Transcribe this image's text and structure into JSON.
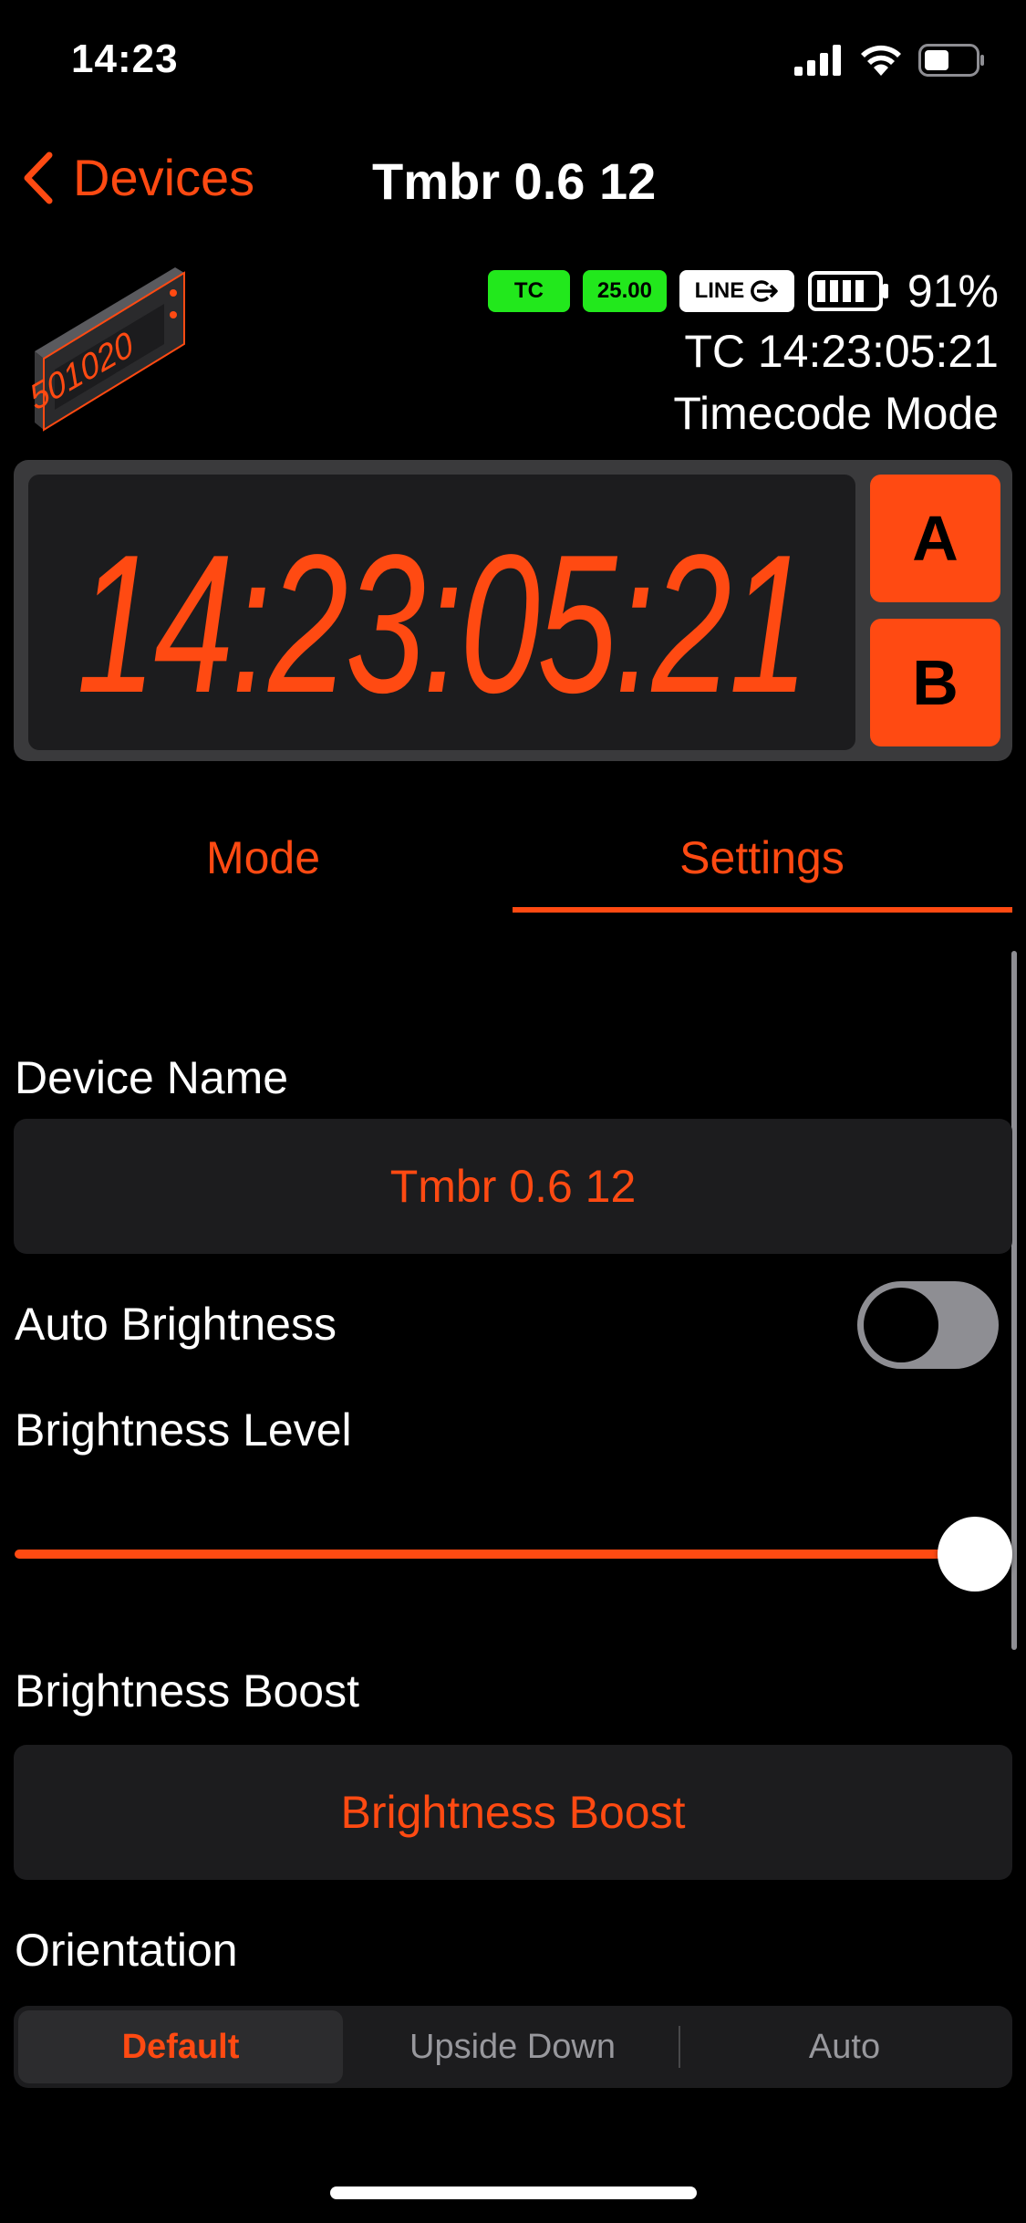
{
  "status_bar": {
    "time": "14:23",
    "icons": [
      "cellular-signal-icon",
      "wifi-icon",
      "battery-icon"
    ]
  },
  "nav": {
    "back_label": "Devices",
    "title": "Tmbr 0.6 12"
  },
  "device_header": {
    "badges": {
      "tc": "TC",
      "fps": "25.00",
      "line": "LINE"
    },
    "battery_percent": "91%",
    "battery_level": 0.91,
    "timecode": "TC 14:23:05:21",
    "mode": "Timecode Mode",
    "thumbnail_text": "501020"
  },
  "display": {
    "timecode": "14:23:05:21",
    "button_a": "A",
    "button_b": "B"
  },
  "tabs": {
    "mode": "Mode",
    "settings": "Settings",
    "selected": "settings"
  },
  "settings": {
    "device_name_label": "Device Name",
    "device_name_value": "Tmbr 0.6 12",
    "auto_brightness_label": "Auto Brightness",
    "auto_brightness_on": false,
    "brightness_level_label": "Brightness Level",
    "brightness_level": 1.0,
    "brightness_boost_label": "Brightness Boost",
    "brightness_boost_button": "Brightness Boost",
    "orientation_label": "Orientation",
    "orientation_options": [
      "Default",
      "Upside Down",
      "Auto"
    ],
    "orientation_selected": "Default"
  },
  "colors": {
    "accent": "#ff4a12",
    "badge_green": "#22e81c",
    "background": "#000000",
    "panel": "#1c1c1e"
  }
}
